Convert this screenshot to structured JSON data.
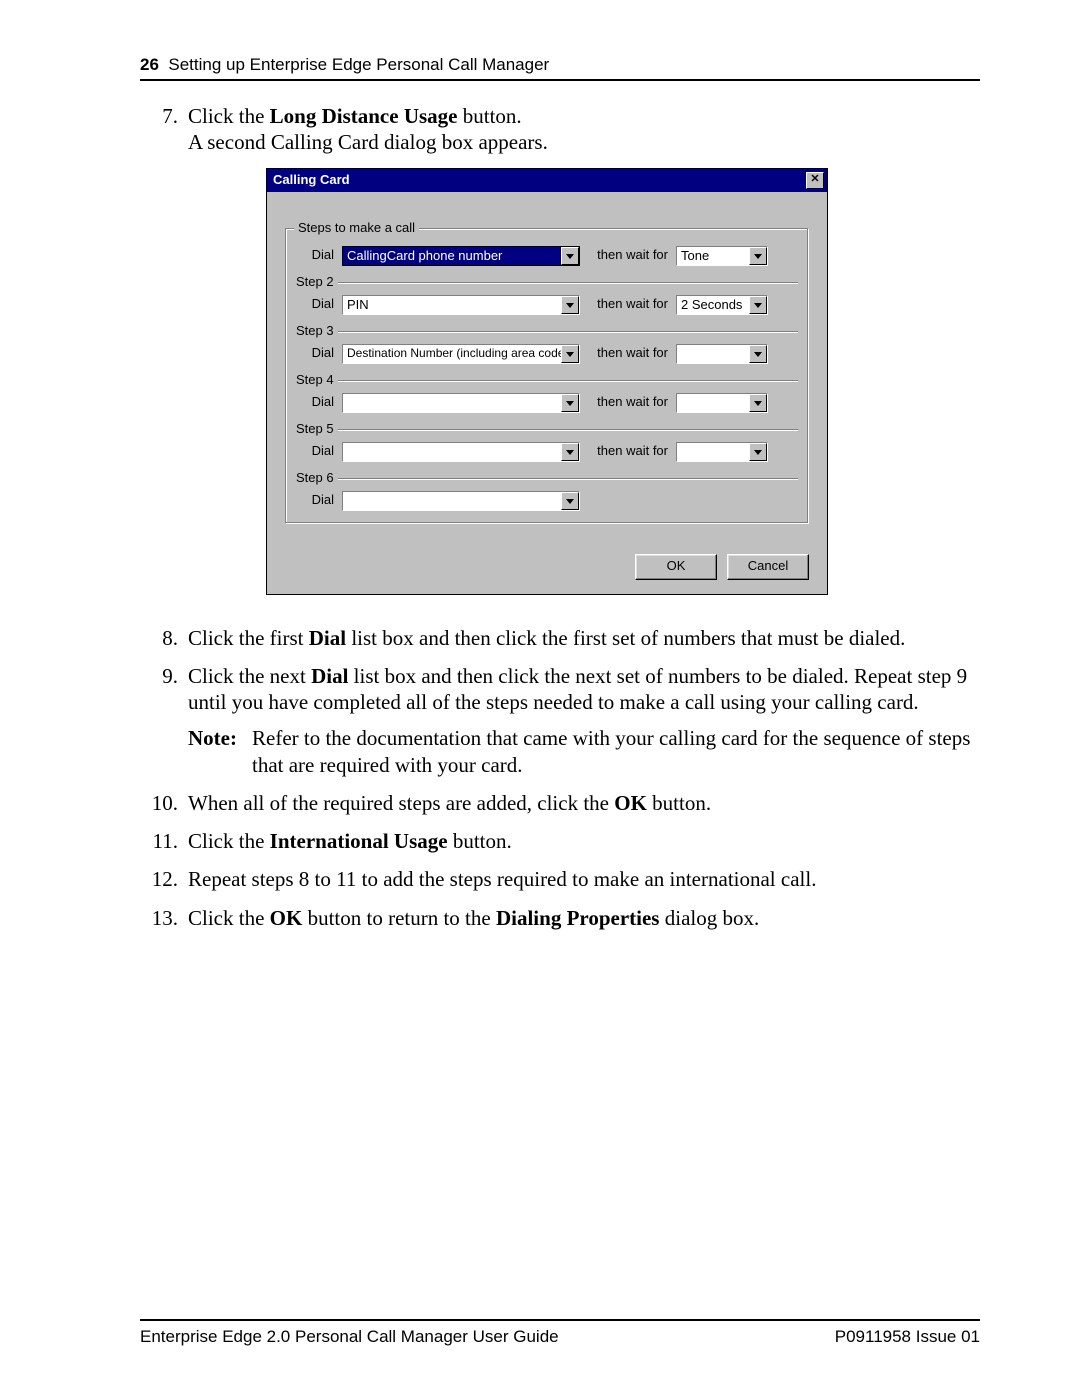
{
  "header": {
    "page_num": "26",
    "title": "Setting up Enterprise Edge Personal Call Manager"
  },
  "footer": {
    "left": "Enterprise Edge 2.0 Personal Call Manager User Guide",
    "right": "P0911958 Issue 01"
  },
  "steps": {
    "s7": {
      "num": "7.",
      "t1a": "Click the ",
      "t1b": "Long Distance Usage",
      "t1c": " button.",
      "t2": "A second Calling Card dialog box appears."
    },
    "s8": {
      "num": "8.",
      "t1a": "Click the first ",
      "t1b": "Dial",
      "t1c": " list box and then click the first set of numbers that must be dialed."
    },
    "s9": {
      "num": "9.",
      "t1a": "Click the next ",
      "t1b": "Dial",
      "t1c": " list box and then click the next set of numbers to be dialed. Repeat step 9 until you have completed all of the steps needed to make a call using your calling card.",
      "note_label": "Note:",
      "note_text": "Refer to the documentation that came with your calling card for the sequence of steps that are required with your card."
    },
    "s10": {
      "num": "10.",
      "t1a": "When all of the required steps are added, click the ",
      "t1b": "OK",
      "t1c": " button."
    },
    "s11": {
      "num": "11.",
      "t1a": "Click the ",
      "t1b": "International Usage",
      "t1c": " button."
    },
    "s12": {
      "num": "12.",
      "t1": "Repeat steps 8 to 11 to add the steps required to make an international call."
    },
    "s13": {
      "num": "13.",
      "t1a": "Click the ",
      "t1b": "OK",
      "t1c": " button to return to the ",
      "t1d": "Dialing Properties",
      "t1e": " dialog box."
    }
  },
  "dialog": {
    "title": "Calling Card",
    "close": "✕",
    "group_legend": "Steps to make a call",
    "dial_label": "Dial",
    "wait_label": "then wait for",
    "step_labels": [
      "Step 2",
      "Step 3",
      "Step 4",
      "Step 5",
      "Step 6"
    ],
    "rows": [
      {
        "dial": "CallingCard phone number",
        "wait": "Tone",
        "highlight": true
      },
      {
        "dial": "PIN",
        "wait": "2 Seconds"
      },
      {
        "dial": "Destination Number (including area code)",
        "wait": ""
      },
      {
        "dial": "",
        "wait": ""
      },
      {
        "dial": "",
        "wait": ""
      },
      {
        "dial": "",
        "wait": null
      }
    ],
    "ok": "OK",
    "cancel": "Cancel"
  }
}
